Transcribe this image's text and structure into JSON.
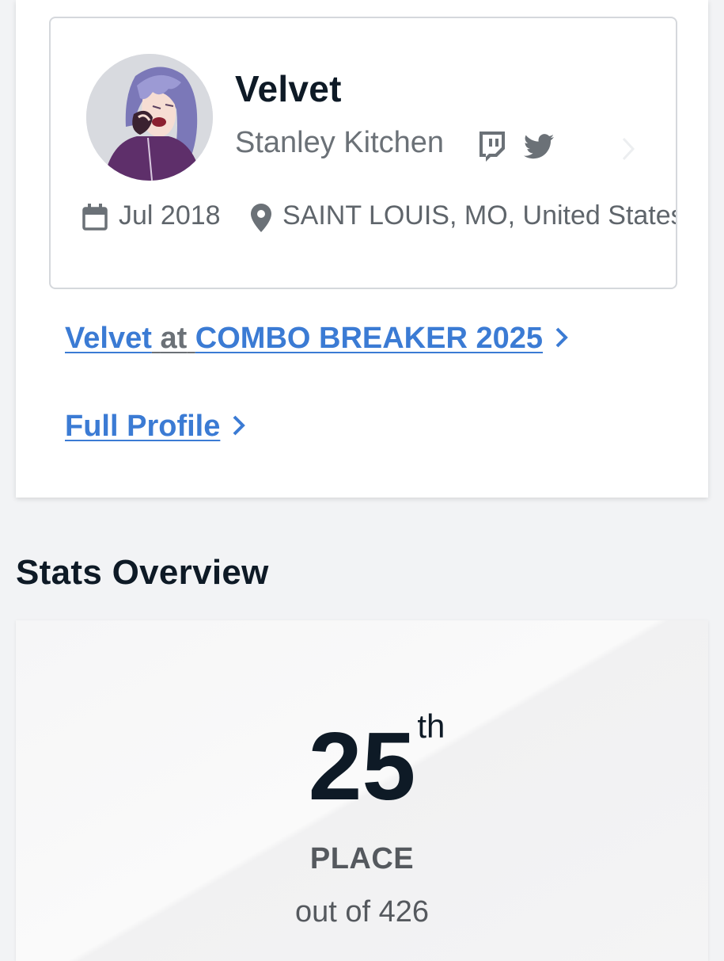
{
  "profile": {
    "name": "Velvet",
    "team": "Stanley Kitchen",
    "join_date": "Jul 2018",
    "location": "SAINT LOUIS, MO, United States",
    "icons": {
      "calendar": "calendar-icon",
      "location": "map-pin-icon",
      "twitch": "twitch-icon",
      "twitter": "twitter-icon"
    }
  },
  "links": {
    "event": {
      "player": "Velvet",
      "connector": "at",
      "event": "COMBO BREAKER 2025"
    },
    "full_profile": "Full Profile"
  },
  "stats": {
    "title": "Stats Overview",
    "place_number": "25",
    "place_suffix": "th",
    "place_label": "PLACE",
    "total": "out of 426"
  },
  "colors": {
    "link": "#3b7bd4",
    "text_dark": "#0e1a26",
    "text_muted": "#6b7177"
  }
}
